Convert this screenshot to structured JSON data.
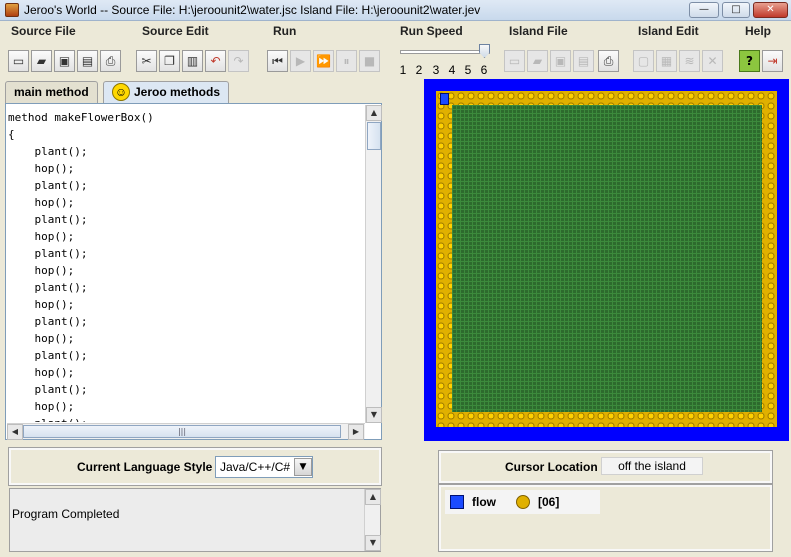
{
  "window": {
    "title": "Jeroo's World -- Source File: H:\\jeroounit2\\water.jsc     Island File: H:\\jeroounit2\\water.jev",
    "minimize": "—",
    "maximize": "□",
    "close": "✕"
  },
  "menu": [
    "Source File",
    "Source Edit",
    "Run",
    "Run Speed",
    "Island File",
    "Island Edit",
    "Help"
  ],
  "run_speed": {
    "ticks": [
      "1",
      "2",
      "3",
      "4",
      "5",
      "6"
    ],
    "selected": 6
  },
  "toolbar_icons": [
    "new-file-icon",
    "open-file-icon",
    "save-file-icon",
    "save-as-icon",
    "print-icon",
    "cut-icon",
    "copy-icon",
    "paste-icon",
    "undo-icon",
    "redo-icon",
    "reset-icon",
    "step-icon",
    "run-icon",
    "pause-icon",
    "stop-icon",
    "new-island-icon",
    "open-island-icon",
    "save-island-icon",
    "save-island-as-icon",
    "print-island-icon",
    "clear-island-icon",
    "grid-icon",
    "edit-island-icon",
    "close-island-icon",
    "help-icon",
    "exit-icon"
  ],
  "tabs": {
    "main": "main method",
    "jeroo": "Jeroo methods"
  },
  "code": [
    "method makeFlowerBox()",
    "{",
    "    plant();",
    "    hop();",
    "    plant();",
    "    hop();",
    "    plant();",
    "    hop();",
    "    plant();",
    "    hop();",
    "    plant();",
    "    hop();",
    "    plant();",
    "    hop();",
    "    plant();",
    "    hop();",
    "    plant();",
    "    hop();",
    "    plant();"
  ],
  "language": {
    "label": "Current Language Style",
    "value": "Java/C++/C#"
  },
  "message": "Program Completed",
  "cursor": {
    "label": "Cursor Location",
    "value": "off the island"
  },
  "status": {
    "jeroo_label": "flow",
    "flower_label": "[06]"
  },
  "colors": {
    "water": "#0000ff",
    "grass": "#2d6b2d",
    "flower": "#e0b000",
    "jeroo": "#1a4aff"
  }
}
